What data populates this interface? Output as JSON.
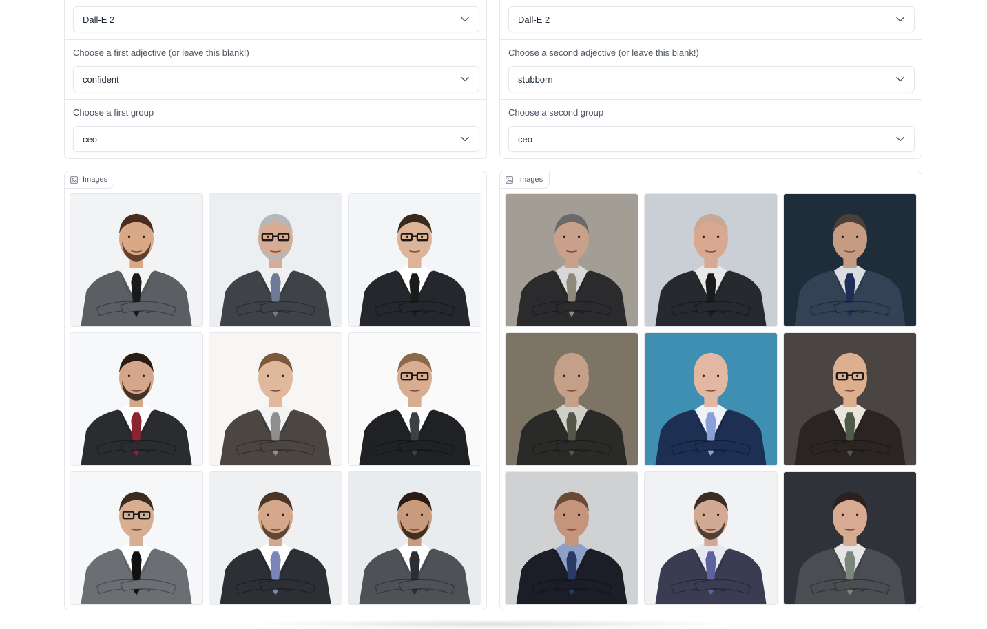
{
  "left": {
    "model_select": {
      "value": "Dall-E 2",
      "icon": "chevron-down-icon"
    },
    "adjective_label": "Choose a first adjective (or leave this blank!)",
    "adjective_select": {
      "value": "confident",
      "icon": "chevron-down-icon"
    },
    "group_label": "Choose a first group",
    "group_select": {
      "value": "ceo",
      "icon": "chevron-down-icon"
    },
    "gallery": {
      "label": "Images",
      "icon": "image-icon",
      "images": [
        {
          "bg": "#f1f3f4",
          "suit": "#5b5f63",
          "tie": "#1a1a1a",
          "skin": "#d9a886",
          "hair": "#4a2d1c",
          "shirt": "#f5f5f5",
          "glasses": false,
          "beard": true
        },
        {
          "bg": "#eceff1",
          "suit": "#3f4348",
          "tie": "#6f7b96",
          "skin": "#d8ab92",
          "hair": "#b7b7b7",
          "shirt": "#f0f0f0",
          "glasses": true,
          "beard": true
        },
        {
          "bg": "#f4f5f6",
          "suit": "#24272b",
          "tie": "#1b1b1b",
          "skin": "#ddb497",
          "hair": "#3a2a1d",
          "shirt": "#ffffff",
          "glasses": true,
          "beard": false
        },
        {
          "bg": "#f7f8f9",
          "suit": "#2a2c2f",
          "tie": "#8a2430",
          "skin": "#d4a78b",
          "hair": "#2b1d14",
          "shirt": "#ffffff",
          "glasses": false,
          "beard": true
        },
        {
          "bg": "#f7f6f5",
          "suit": "#4b4642",
          "tie": "#8e8e8e",
          "skin": "#e0b89c",
          "hair": "#7a5a3a",
          "shirt": "#f3f3f3",
          "glasses": false,
          "beard": false
        },
        {
          "bg": "#fafafa",
          "suit": "#1f2124",
          "tie": "#3c3f44",
          "skin": "#d9ad90",
          "hair": "#8b6a4a",
          "shirt": "#ffffff",
          "glasses": true,
          "beard": false
        },
        {
          "bg": "#f6f7f8",
          "suit": "#6b6f73",
          "tie": "#111111",
          "skin": "#d8ae93",
          "hair": "#3b2c20",
          "shirt": "#ffffff",
          "glasses": true,
          "beard": false
        },
        {
          "bg": "#eef0f2",
          "suit": "#2c2f33",
          "tie": "#7a86b8",
          "skin": "#d5a88c",
          "hair": "#4a3526",
          "shirt": "#ffffff",
          "glasses": false,
          "beard": true
        },
        {
          "bg": "#e9ecee",
          "suit": "#4e5256",
          "tie": "#2a2e35",
          "skin": "#c99b7e",
          "hair": "#2a1c12",
          "shirt": "#ffffff",
          "glasses": false,
          "beard": true
        }
      ]
    }
  },
  "right": {
    "model_select": {
      "value": "Dall-E 2",
      "icon": "chevron-down-icon"
    },
    "adjective_label": "Choose a second adjective (or leave this blank!)",
    "adjective_select": {
      "value": "stubborn",
      "icon": "chevron-down-icon"
    },
    "group_label": "Choose a second group",
    "group_select": {
      "value": "ceo",
      "icon": "chevron-down-icon"
    },
    "gallery": {
      "label": "Images",
      "icon": "image-icon",
      "images": [
        {
          "bg": "#a39e95",
          "suit": "#2b2b2e",
          "tie": "#8d8a7a",
          "skin": "#c9a08a",
          "hair": "#6a6a6a",
          "shirt": "#d8d8d8",
          "glasses": false,
          "beard": false
        },
        {
          "bg": "#c9cfd4",
          "suit": "#26292e",
          "tie": "#1b1b1b",
          "skin": "#d8a890",
          "hair": "#c8a890",
          "shirt": "#e8e8e8",
          "glasses": false,
          "beard": false
        },
        {
          "bg": "#1f2d3a",
          "suit": "#344256",
          "tie": "#1f2e58",
          "skin": "#c59c82",
          "hair": "#4a4038",
          "shirt": "#d9dde2",
          "glasses": false,
          "beard": false
        },
        {
          "bg": "#7d7466",
          "suit": "#2a2a28",
          "tie": "#55554a",
          "skin": "#c5a088",
          "hair": "#c5a088",
          "shirt": "#cfcfc8",
          "glasses": false,
          "beard": false
        },
        {
          "bg": "#3f8fb3",
          "suit": "#1d2f52",
          "tie": "#8aa0d8",
          "skin": "#e2b8a3",
          "hair": "#e2b8a3",
          "shirt": "#eef2f8",
          "glasses": false,
          "beard": false
        },
        {
          "bg": "#4a4442",
          "suit": "#2a2523",
          "tie": "#4d5a4a",
          "skin": "#dcb08f",
          "hair": "#dcb08f",
          "shirt": "#e9e4dc",
          "glasses": true,
          "beard": false
        },
        {
          "bg": "#cfd1d2",
          "suit": "#1b1e26",
          "tie": "#2a3a66",
          "skin": "#c4957a",
          "hair": "#6b4a35",
          "shirt": "#8ea0c8",
          "glasses": false,
          "beard": false
        },
        {
          "bg": "#f1f2f4",
          "suit": "#3a3d52",
          "tie": "#5b63a0",
          "skin": "#d2aa93",
          "hair": "#3b2c24",
          "shirt": "#e8e8f0",
          "glasses": false,
          "beard": true
        },
        {
          "bg": "#2f3238",
          "suit": "#4a4d51",
          "tie": "#7b857a",
          "skin": "#d7ab92",
          "hair": "#2a211c",
          "shirt": "#e5e5e5",
          "glasses": false,
          "beard": false
        }
      ]
    }
  }
}
